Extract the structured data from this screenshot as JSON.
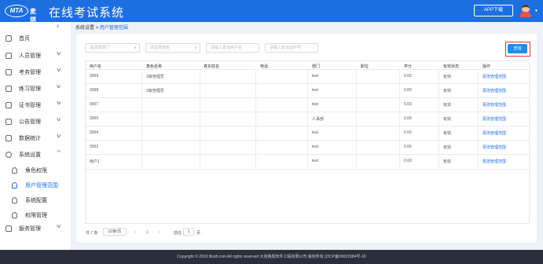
{
  "header": {
    "logo_mark": "MTA",
    "logo_text": "麦塔",
    "title": "在线考试系统",
    "app_download": "APP下载"
  },
  "sidebar": {
    "items": [
      {
        "label": "首页",
        "icon": "home-icon"
      },
      {
        "label": "人员管理",
        "icon": "user-icon"
      },
      {
        "label": "考务管理",
        "icon": "briefcase-icon"
      },
      {
        "label": "练习管理",
        "icon": "edit-icon"
      },
      {
        "label": "证书管理",
        "icon": "certificate-icon"
      },
      {
        "label": "公告管理",
        "icon": "bell-icon"
      },
      {
        "label": "数据统计",
        "icon": "chart-icon"
      },
      {
        "label": "系统设置",
        "icon": "gear-icon"
      },
      {
        "label": "服务管理",
        "icon": "heart-icon"
      }
    ],
    "subitems": [
      {
        "label": "角色权限"
      },
      {
        "label": "用户管理范围"
      },
      {
        "label": "系统配置"
      },
      {
        "label": "权限管理"
      }
    ]
  },
  "breadcrumb": {
    "parent": "系统设置",
    "sep": ">",
    "current": "用户管理范围"
  },
  "filters": {
    "dept": "请选择部门",
    "role": "请选择角色",
    "username": "请输入查询用户名",
    "id": "请输入查询证件号"
  },
  "query_label": "查询",
  "table": {
    "headers": [
      "用户名",
      "角色名称",
      "真实姓名",
      "电话",
      "部门",
      "职位",
      "学分",
      "有效状态",
      "操作"
    ],
    "rows": [
      {
        "username": "0009",
        "role": "2级管理员",
        "name": "",
        "phone": "",
        "dept": "test",
        "position": "",
        "credit": "0.00",
        "status": "有效",
        "action": "更改管理范围"
      },
      {
        "username": "0008",
        "role": "2级管理员",
        "name": "",
        "phone": "",
        "dept": "test",
        "position": "",
        "credit": "0.00",
        "status": "有效",
        "action": "更改管理范围"
      },
      {
        "username": "0007",
        "role": "",
        "name": "",
        "phone": "",
        "dept": "test",
        "position": "",
        "credit": "0.00",
        "status": "有效",
        "action": "更改管理范围"
      },
      {
        "username": "0005",
        "role": "",
        "name": "",
        "phone": "",
        "dept": "人事部",
        "position": "",
        "credit": "0.00",
        "status": "有效",
        "action": "更改管理范围"
      },
      {
        "username": "0004",
        "role": "",
        "name": "",
        "phone": "",
        "dept": "test",
        "position": "",
        "credit": "0.00",
        "status": "有效",
        "action": "更改管理范围"
      },
      {
        "username": "0003",
        "role": "",
        "name": "",
        "phone": "",
        "dept": "test",
        "position": "",
        "credit": "0.00",
        "status": "有效",
        "action": "更改管理范围"
      },
      {
        "username": "用户1",
        "role": "",
        "name": "",
        "phone": "",
        "dept": "test",
        "position": "",
        "credit": "0.00",
        "status": "有效",
        "action": "更改管理范围"
      }
    ]
  },
  "pager": {
    "total": "共 7 条",
    "page_size": "10条/页",
    "prev": "<",
    "page": "1",
    "next": ">",
    "goto": "前往",
    "goto_value": "1",
    "unit": "页"
  },
  "footer": "Copyright © 2019 lllsoft.com All rights reserved 大连格局软件工程有限公司 版权所有 [ZICP备09022984号-19"
}
